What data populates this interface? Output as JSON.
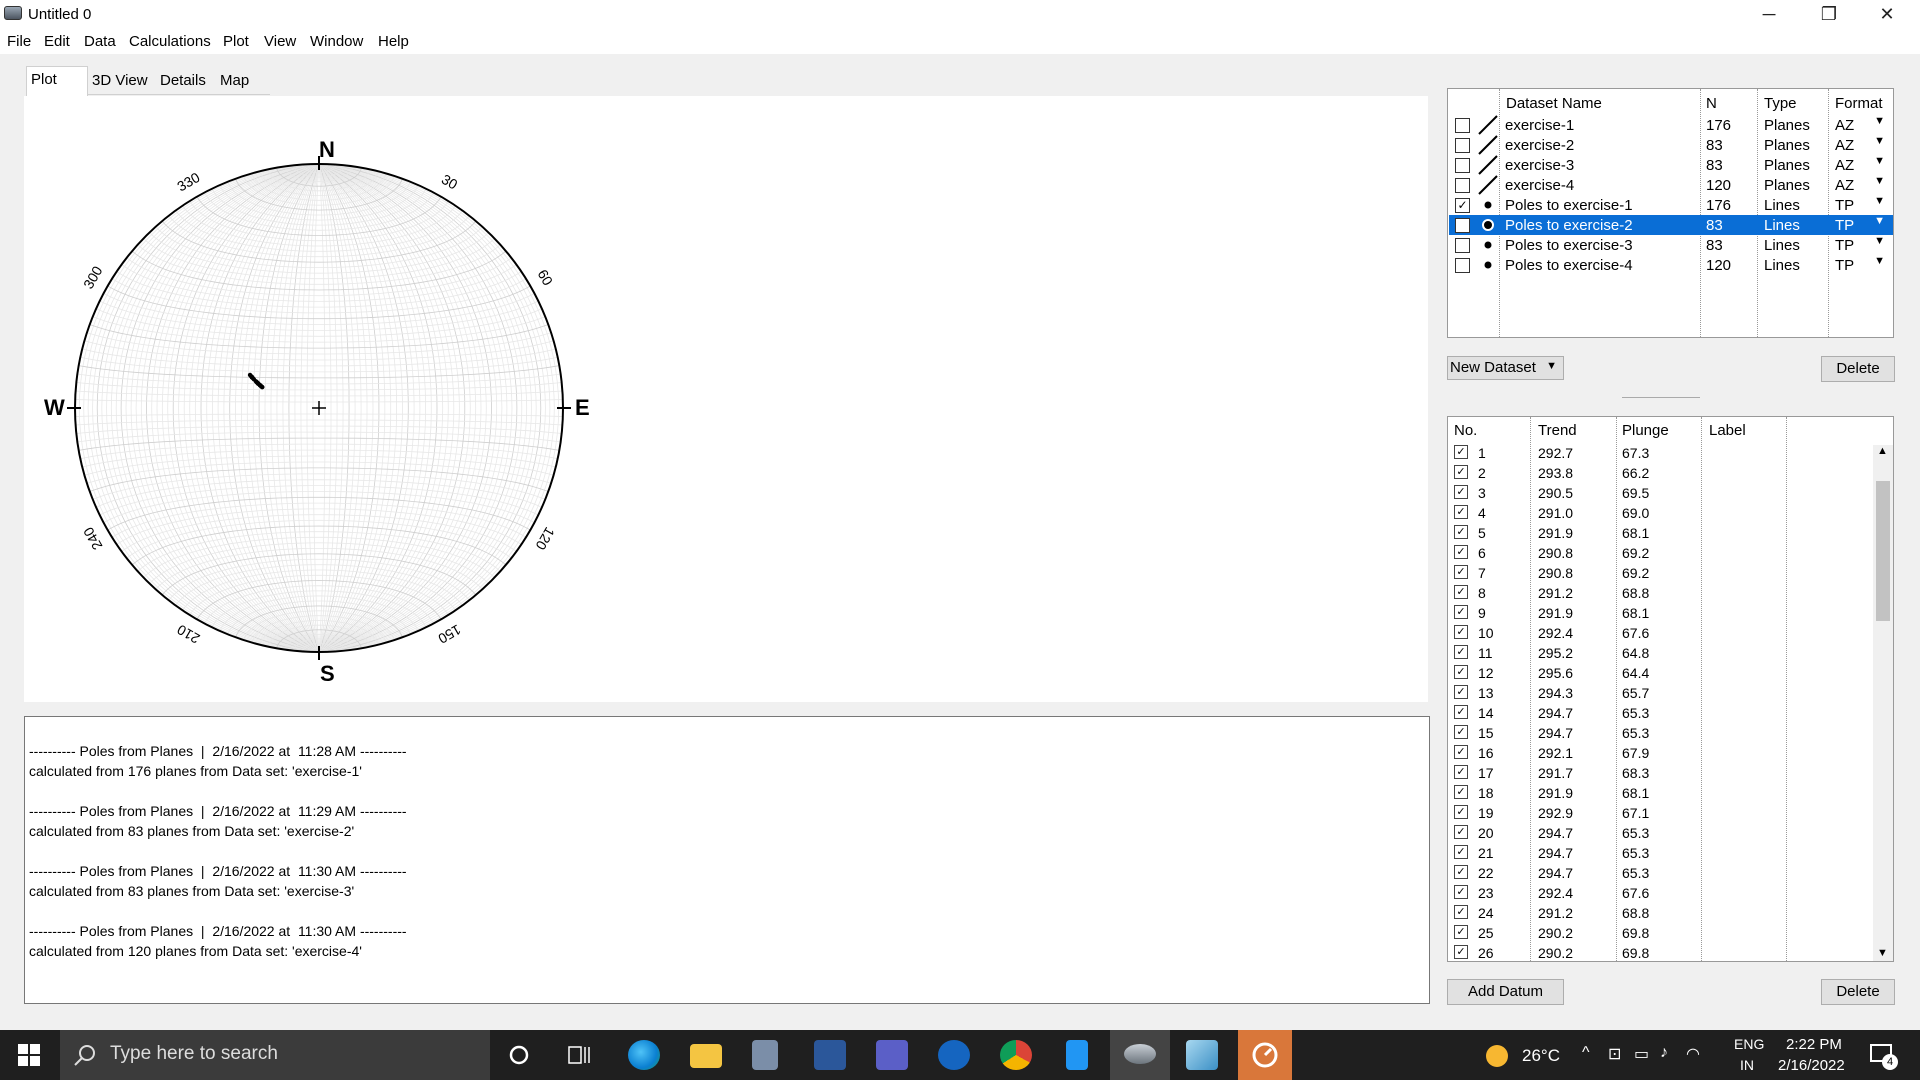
{
  "window": {
    "title": "Untitled 0",
    "minimize": "─",
    "maximize": "❐",
    "close": "✕"
  },
  "menu": [
    "File",
    "Edit",
    "Data",
    "Calculations",
    "Plot",
    "View",
    "Window",
    "Help"
  ],
  "tabs": [
    "Plot",
    "3D View",
    "Details",
    "Map"
  ],
  "stereonet": {
    "cardinals": {
      "N": "N",
      "S": "S",
      "E": "E",
      "W": "W"
    },
    "azimuth_labels": [
      "30",
      "60",
      "120",
      "150",
      "210",
      "240",
      "300",
      "330"
    ],
    "poles": [
      {
        "trend": 292.7,
        "plunge": 67.3
      },
      {
        "trend": 293.8,
        "plunge": 66.2
      },
      {
        "trend": 290.5,
        "plunge": 69.5
      },
      {
        "trend": 291.0,
        "plunge": 69.0
      },
      {
        "trend": 291.9,
        "plunge": 68.1
      },
      {
        "trend": 290.8,
        "plunge": 69.2
      },
      {
        "trend": 290.8,
        "plunge": 69.2
      },
      {
        "trend": 291.2,
        "plunge": 68.8
      },
      {
        "trend": 291.9,
        "plunge": 68.1
      },
      {
        "trend": 292.4,
        "plunge": 67.6
      },
      {
        "trend": 295.2,
        "plunge": 64.8
      },
      {
        "trend": 295.6,
        "plunge": 64.4
      },
      {
        "trend": 294.3,
        "plunge": 65.7
      },
      {
        "trend": 294.7,
        "plunge": 65.3
      },
      {
        "trend": 294.7,
        "plunge": 65.3
      },
      {
        "trend": 292.1,
        "plunge": 67.9
      },
      {
        "trend": 291.7,
        "plunge": 68.3
      },
      {
        "trend": 291.9,
        "plunge": 68.1
      },
      {
        "trend": 292.9,
        "plunge": 67.1
      },
      {
        "trend": 294.7,
        "plunge": 65.3
      },
      {
        "trend": 294.7,
        "plunge": 65.3
      },
      {
        "trend": 294.7,
        "plunge": 65.3
      },
      {
        "trend": 292.4,
        "plunge": 67.6
      },
      {
        "trend": 291.2,
        "plunge": 68.8
      },
      {
        "trend": 290.2,
        "plunge": 69.8
      },
      {
        "trend": 290.2,
        "plunge": 69.8
      }
    ]
  },
  "log": [
    "---------- Poles from Planes  |  2/16/2022 at  11:28 AM ----------",
    "calculated from 176 planes from Data set: 'exercise-1'",
    "---------- Poles from Planes  |  2/16/2022 at  11:29 AM ----------",
    "calculated from 83 planes from Data set: 'exercise-2'",
    "---------- Poles from Planes  |  2/16/2022 at  11:30 AM ----------",
    "calculated from 83 planes from Data set: 'exercise-3'",
    "---------- Poles from Planes  |  2/16/2022 at  11:30 AM ----------",
    "calculated from 120 planes from Data set: 'exercise-4'"
  ],
  "dataset_table": {
    "headers": {
      "name": "Dataset Name",
      "n": "N",
      "type": "Type",
      "format": "Format"
    },
    "rows": [
      {
        "name": "exercise-1",
        "n": "176",
        "type": "Planes",
        "format": "AZ",
        "symbol": "line",
        "checked": false,
        "selected": false
      },
      {
        "name": "exercise-2",
        "n": "83",
        "type": "Planes",
        "format": "AZ",
        "symbol": "line",
        "checked": false,
        "selected": false
      },
      {
        "name": "exercise-3",
        "n": "83",
        "type": "Planes",
        "format": "AZ",
        "symbol": "line",
        "checked": false,
        "selected": false
      },
      {
        "name": "exercise-4",
        "n": "120",
        "type": "Planes",
        "format": "AZ",
        "symbol": "line",
        "checked": false,
        "selected": false
      },
      {
        "name": "Poles to exercise-1",
        "n": "176",
        "type": "Lines",
        "format": "TP",
        "symbol": "dot",
        "checked": true,
        "selected": false
      },
      {
        "name": "Poles to exercise-2",
        "n": "83",
        "type": "Lines",
        "format": "TP",
        "symbol": "dot",
        "checked": false,
        "selected": true
      },
      {
        "name": "Poles to exercise-3",
        "n": "83",
        "type": "Lines",
        "format": "TP",
        "symbol": "dot",
        "checked": false,
        "selected": false
      },
      {
        "name": "Poles to exercise-4",
        "n": "120",
        "type": "Lines",
        "format": "TP",
        "symbol": "dot",
        "checked": false,
        "selected": false
      }
    ]
  },
  "buttons": {
    "new_dataset": "New Dataset",
    "delete_dataset": "Delete",
    "add_datum": "Add Datum",
    "delete_datum": "Delete"
  },
  "datum_table": {
    "headers": {
      "no": "No.",
      "trend": "Trend",
      "plunge": "Plunge",
      "label": "Label"
    },
    "rows": [
      {
        "no": "1",
        "trend": "292.7",
        "plunge": "67.3"
      },
      {
        "no": "2",
        "trend": "293.8",
        "plunge": "66.2"
      },
      {
        "no": "3",
        "trend": "290.5",
        "plunge": "69.5"
      },
      {
        "no": "4",
        "trend": "291.0",
        "plunge": "69.0"
      },
      {
        "no": "5",
        "trend": "291.9",
        "plunge": "68.1"
      },
      {
        "no": "6",
        "trend": "290.8",
        "plunge": "69.2"
      },
      {
        "no": "7",
        "trend": "290.8",
        "plunge": "69.2"
      },
      {
        "no": "8",
        "trend": "291.2",
        "plunge": "68.8"
      },
      {
        "no": "9",
        "trend": "291.9",
        "plunge": "68.1"
      },
      {
        "no": "10",
        "trend": "292.4",
        "plunge": "67.6"
      },
      {
        "no": "11",
        "trend": "295.2",
        "plunge": "64.8"
      },
      {
        "no": "12",
        "trend": "295.6",
        "plunge": "64.4"
      },
      {
        "no": "13",
        "trend": "294.3",
        "plunge": "65.7"
      },
      {
        "no": "14",
        "trend": "294.7",
        "plunge": "65.3"
      },
      {
        "no": "15",
        "trend": "294.7",
        "plunge": "65.3"
      },
      {
        "no": "16",
        "trend": "292.1",
        "plunge": "67.9"
      },
      {
        "no": "17",
        "trend": "291.7",
        "plunge": "68.3"
      },
      {
        "no": "18",
        "trend": "291.9",
        "plunge": "68.1"
      },
      {
        "no": "19",
        "trend": "292.9",
        "plunge": "67.1"
      },
      {
        "no": "20",
        "trend": "294.7",
        "plunge": "65.3"
      },
      {
        "no": "21",
        "trend": "294.7",
        "plunge": "65.3"
      },
      {
        "no": "22",
        "trend": "294.7",
        "plunge": "65.3"
      },
      {
        "no": "23",
        "trend": "292.4",
        "plunge": "67.6"
      },
      {
        "no": "24",
        "trend": "291.2",
        "plunge": "68.8"
      },
      {
        "no": "25",
        "trend": "290.2",
        "plunge": "69.8"
      },
      {
        "no": "26",
        "trend": "290.2",
        "plunge": "69.8"
      }
    ]
  },
  "taskbar": {
    "search_placeholder": "Type here to search",
    "weather": "26°C",
    "lang1": "ENG",
    "lang2": "IN",
    "time": "2:22 PM",
    "date": "2/16/2022",
    "notifications": "4"
  }
}
